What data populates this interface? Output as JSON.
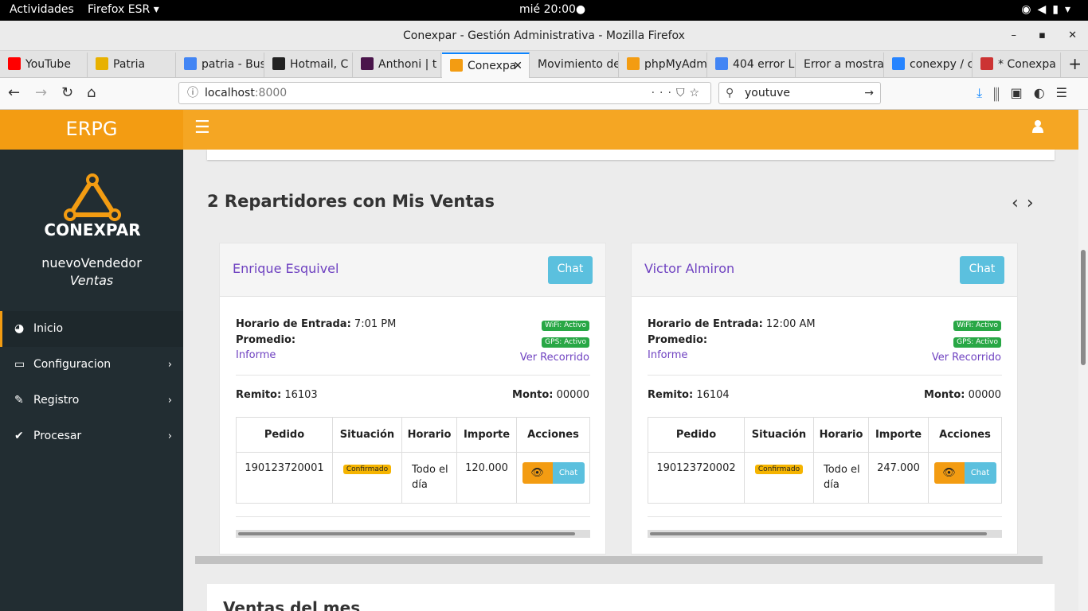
{
  "system": {
    "activities": "Actividades",
    "app": "Firefox ESR ▾",
    "clock": "mié 20:00●"
  },
  "window": {
    "title": "Conexpar - Gestión Administrativa - Mozilla Firefox"
  },
  "tabs": [
    {
      "label": "YouTube",
      "color": "#ff0000"
    },
    {
      "label": "Patria",
      "color": "#e8b100"
    },
    {
      "label": "patria - Bus",
      "color": "#4285f4"
    },
    {
      "label": "Hotmail, C",
      "color": "#222222"
    },
    {
      "label": "Anthoni | t",
      "color": "#4a154b"
    },
    {
      "label": "Conexpa",
      "color": "#f39c12"
    },
    {
      "label": "Movimiento de",
      "color": "#cccccc"
    },
    {
      "label": "phpMyAdm",
      "color": "#f39c12"
    },
    {
      "label": "404 error L",
      "color": "#4285f4"
    },
    {
      "label": "Error a mostra",
      "color": "#cccccc"
    },
    {
      "label": "conexpy / c",
      "color": "#2684ff"
    },
    {
      "label": "* Conexpa",
      "color": "#cc3333"
    }
  ],
  "nav": {
    "host": "localhost",
    "port": ":8000",
    "search": "youtuve"
  },
  "sidebar": {
    "brand": "ERPG",
    "logo_text": "CONEXPAR",
    "user": "nuevoVendedor",
    "role": "Ventas",
    "items": [
      {
        "label": "Inicio",
        "icon": "dashboard-icon"
      },
      {
        "label": "Configuracion",
        "icon": "laptop-icon"
      },
      {
        "label": "Registro",
        "icon": "edit-icon"
      },
      {
        "label": "Procesar",
        "icon": "check-icon"
      }
    ]
  },
  "section": {
    "title": "2 Repartidores con Mis Ventas",
    "next_title": "Ventas del mes"
  },
  "labels": {
    "entrada": "Horario de Entrada:",
    "promedio": "Promedio:",
    "informe": "Informe",
    "recorrido": "Ver Recorrido",
    "remito": "Remito:",
    "monto": "Monto:",
    "wifi": "WiFi: Activo",
    "gps": "GPS: Activo",
    "chat": "Chat",
    "confirmado": "Confirmado"
  },
  "table_headers": [
    "Pedido",
    "Situación",
    "Horario",
    "Importe",
    "Acciones"
  ],
  "cards": [
    {
      "name": "Enrique Esquivel",
      "entrada": "7:01 PM",
      "remito": "16103",
      "monto": "00000",
      "pedido": "190123720001",
      "horario": "Todo el día",
      "importe": "120.000"
    },
    {
      "name": "Victor Almiron",
      "entrada": "12:00 AM",
      "remito": "16104",
      "monto": "00000",
      "pedido": "190123720002",
      "horario": "Todo el día",
      "importe": "247.000"
    }
  ]
}
